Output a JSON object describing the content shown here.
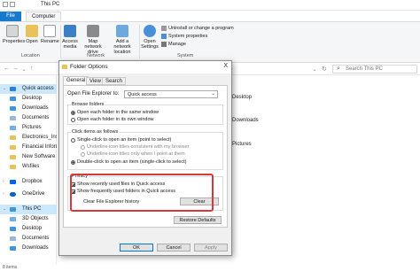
{
  "explorer": {
    "title": "This PC",
    "tabs": {
      "file": "File",
      "computer": "Computer"
    },
    "ribbon": {
      "properties": "Properties",
      "open": "Open",
      "rename": "Rename",
      "access_media": "Access media",
      "map_network_drive": "Map network drive",
      "add_network_location": "Add a network location",
      "open_settings": "Open Settings",
      "uninstall": "Uninstall or change a program",
      "system_properties": "System properties",
      "manage": "Manage",
      "group_location": "Location",
      "group_network": "Network",
      "group_system": "System"
    },
    "search_placeholder": "Search This PC",
    "nav": [
      {
        "label": "Quick access",
        "selected": true
      },
      {
        "label": "Desktop"
      },
      {
        "label": "Downloads"
      },
      {
        "label": "Documents"
      },
      {
        "label": "Pictures"
      },
      {
        "label": "Electronics_Instr"
      },
      {
        "label": "Financial Inform"
      },
      {
        "label": "New Software"
      },
      {
        "label": "Wsfiles"
      },
      {
        "label": "Dropbox"
      },
      {
        "label": "OneDrive"
      },
      {
        "label": "This PC",
        "selected": true
      },
      {
        "label": "3D Objects"
      },
      {
        "label": "Desktop"
      },
      {
        "label": "Documents"
      },
      {
        "label": "Downloads"
      }
    ],
    "right_items": [
      "Desktop",
      "Downloads",
      "Pictures"
    ],
    "status": "8 items"
  },
  "dialog": {
    "title": "Folder Options",
    "close": "X",
    "tabs": [
      "General",
      "View",
      "Search"
    ],
    "open_explorer_label": "Open File Explorer to:",
    "open_explorer_value": "Quick access",
    "browse_folders": {
      "legend": "Browse folders",
      "options": [
        "Open each folder in the same window",
        "Open each folder in its own window"
      ],
      "selected": 0
    },
    "click_items": {
      "legend": "Click items as follows",
      "single_click": "Single-click to open an item (point to select)",
      "sub1": "Underline icon titles consistent with my browser",
      "sub2": "Underline icon titles only when I point at them",
      "double_click": "Double-click to open an item (single-click to select)"
    },
    "privacy": {
      "legend": "Privacy",
      "recent_files": "Show recently used files in Quick access",
      "frequent_folders": "Show frequently used folders in Quick access",
      "clear_label": "Clear File Explorer history",
      "clear_button": "Clear"
    },
    "restore_defaults": "Restore Defaults",
    "ok": "OK",
    "cancel": "Cancel",
    "apply": "Apply"
  },
  "colors": {
    "accent": "#1979ca",
    "highlight": "#d9383a",
    "selection": "#cce8ff"
  }
}
